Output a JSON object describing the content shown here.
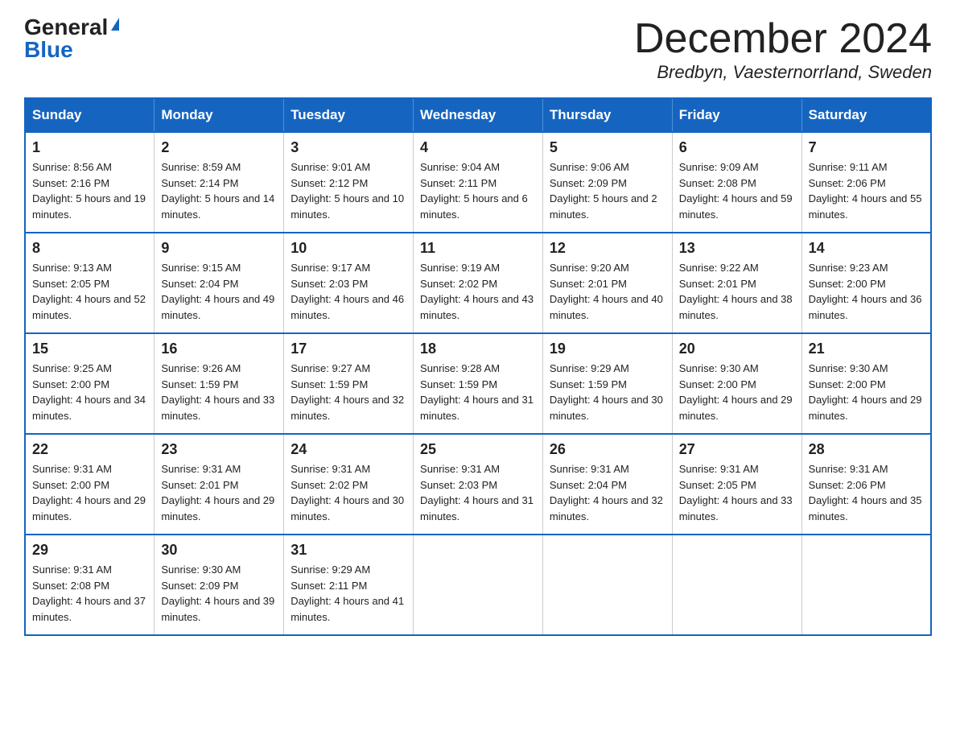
{
  "header": {
    "logo_general": "General",
    "logo_blue": "Blue",
    "month_title": "December 2024",
    "location": "Bredbyn, Vaesternorrland, Sweden"
  },
  "weekdays": [
    "Sunday",
    "Monday",
    "Tuesday",
    "Wednesday",
    "Thursday",
    "Friday",
    "Saturday"
  ],
  "weeks": [
    [
      {
        "day": "1",
        "sunrise": "8:56 AM",
        "sunset": "2:16 PM",
        "daylight": "5 hours and 19 minutes."
      },
      {
        "day": "2",
        "sunrise": "8:59 AM",
        "sunset": "2:14 PM",
        "daylight": "5 hours and 14 minutes."
      },
      {
        "day": "3",
        "sunrise": "9:01 AM",
        "sunset": "2:12 PM",
        "daylight": "5 hours and 10 minutes."
      },
      {
        "day": "4",
        "sunrise": "9:04 AM",
        "sunset": "2:11 PM",
        "daylight": "5 hours and 6 minutes."
      },
      {
        "day": "5",
        "sunrise": "9:06 AM",
        "sunset": "2:09 PM",
        "daylight": "5 hours and 2 minutes."
      },
      {
        "day": "6",
        "sunrise": "9:09 AM",
        "sunset": "2:08 PM",
        "daylight": "4 hours and 59 minutes."
      },
      {
        "day": "7",
        "sunrise": "9:11 AM",
        "sunset": "2:06 PM",
        "daylight": "4 hours and 55 minutes."
      }
    ],
    [
      {
        "day": "8",
        "sunrise": "9:13 AM",
        "sunset": "2:05 PM",
        "daylight": "4 hours and 52 minutes."
      },
      {
        "day": "9",
        "sunrise": "9:15 AM",
        "sunset": "2:04 PM",
        "daylight": "4 hours and 49 minutes."
      },
      {
        "day": "10",
        "sunrise": "9:17 AM",
        "sunset": "2:03 PM",
        "daylight": "4 hours and 46 minutes."
      },
      {
        "day": "11",
        "sunrise": "9:19 AM",
        "sunset": "2:02 PM",
        "daylight": "4 hours and 43 minutes."
      },
      {
        "day": "12",
        "sunrise": "9:20 AM",
        "sunset": "2:01 PM",
        "daylight": "4 hours and 40 minutes."
      },
      {
        "day": "13",
        "sunrise": "9:22 AM",
        "sunset": "2:01 PM",
        "daylight": "4 hours and 38 minutes."
      },
      {
        "day": "14",
        "sunrise": "9:23 AM",
        "sunset": "2:00 PM",
        "daylight": "4 hours and 36 minutes."
      }
    ],
    [
      {
        "day": "15",
        "sunrise": "9:25 AM",
        "sunset": "2:00 PM",
        "daylight": "4 hours and 34 minutes."
      },
      {
        "day": "16",
        "sunrise": "9:26 AM",
        "sunset": "1:59 PM",
        "daylight": "4 hours and 33 minutes."
      },
      {
        "day": "17",
        "sunrise": "9:27 AM",
        "sunset": "1:59 PM",
        "daylight": "4 hours and 32 minutes."
      },
      {
        "day": "18",
        "sunrise": "9:28 AM",
        "sunset": "1:59 PM",
        "daylight": "4 hours and 31 minutes."
      },
      {
        "day": "19",
        "sunrise": "9:29 AM",
        "sunset": "1:59 PM",
        "daylight": "4 hours and 30 minutes."
      },
      {
        "day": "20",
        "sunrise": "9:30 AM",
        "sunset": "2:00 PM",
        "daylight": "4 hours and 29 minutes."
      },
      {
        "day": "21",
        "sunrise": "9:30 AM",
        "sunset": "2:00 PM",
        "daylight": "4 hours and 29 minutes."
      }
    ],
    [
      {
        "day": "22",
        "sunrise": "9:31 AM",
        "sunset": "2:00 PM",
        "daylight": "4 hours and 29 minutes."
      },
      {
        "day": "23",
        "sunrise": "9:31 AM",
        "sunset": "2:01 PM",
        "daylight": "4 hours and 29 minutes."
      },
      {
        "day": "24",
        "sunrise": "9:31 AM",
        "sunset": "2:02 PM",
        "daylight": "4 hours and 30 minutes."
      },
      {
        "day": "25",
        "sunrise": "9:31 AM",
        "sunset": "2:03 PM",
        "daylight": "4 hours and 31 minutes."
      },
      {
        "day": "26",
        "sunrise": "9:31 AM",
        "sunset": "2:04 PM",
        "daylight": "4 hours and 32 minutes."
      },
      {
        "day": "27",
        "sunrise": "9:31 AM",
        "sunset": "2:05 PM",
        "daylight": "4 hours and 33 minutes."
      },
      {
        "day": "28",
        "sunrise": "9:31 AM",
        "sunset": "2:06 PM",
        "daylight": "4 hours and 35 minutes."
      }
    ],
    [
      {
        "day": "29",
        "sunrise": "9:31 AM",
        "sunset": "2:08 PM",
        "daylight": "4 hours and 37 minutes."
      },
      {
        "day": "30",
        "sunrise": "9:30 AM",
        "sunset": "2:09 PM",
        "daylight": "4 hours and 39 minutes."
      },
      {
        "day": "31",
        "sunrise": "9:29 AM",
        "sunset": "2:11 PM",
        "daylight": "4 hours and 41 minutes."
      },
      null,
      null,
      null,
      null
    ]
  ]
}
